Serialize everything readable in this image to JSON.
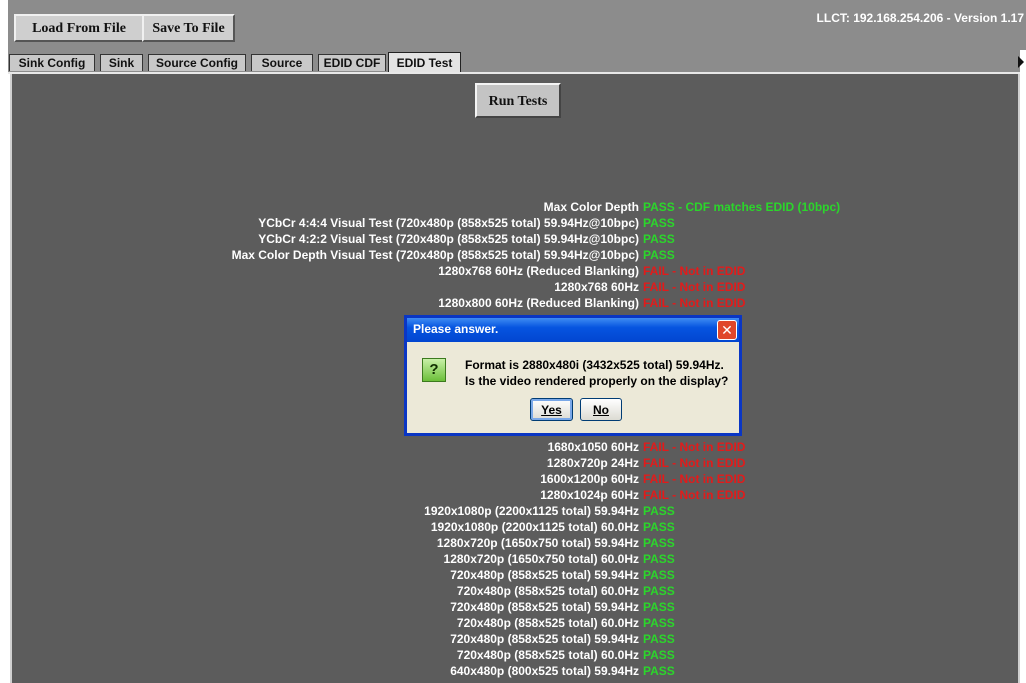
{
  "toolbar": {
    "load_label": "Load From File",
    "save_label": "Save To File",
    "title": "LLCT:  192.168.254.206 - Version 1.17"
  },
  "tabs": [
    {
      "label": "Sink Config"
    },
    {
      "label": "Sink"
    },
    {
      "label": "Source Config"
    },
    {
      "label": "Source"
    },
    {
      "label": "EDID CDF"
    },
    {
      "label": "EDID Test",
      "active": true
    }
  ],
  "run_tests_label": "Run Tests",
  "results": [
    {
      "label": "Max Color Depth",
      "result": "PASS - CDF matches EDID (10bpc)",
      "status": "pass"
    },
    {
      "label": "YCbCr 4:4:4 Visual Test (720x480p (858x525 total) 59.94Hz@10bpc)",
      "result": "PASS",
      "status": "pass"
    },
    {
      "label": "YCbCr 4:2:2 Visual Test (720x480p (858x525 total) 59.94Hz@10bpc)",
      "result": "PASS",
      "status": "pass"
    },
    {
      "label": "Max Color Depth Visual Test (720x480p (858x525 total) 59.94Hz@10bpc)",
      "result": "PASS",
      "status": "pass"
    },
    {
      "label": "1280x768 60Hz (Reduced Blanking)",
      "result": "FAIL - Not in EDID",
      "status": "fail"
    },
    {
      "label": "1280x768 60Hz",
      "result": "FAIL - Not in EDID",
      "status": "fail"
    },
    {
      "label": "1280x800 60Hz (Reduced Blanking)",
      "result": "FAIL - Not in EDID",
      "status": "fail"
    },
    {
      "label": "1680x1050 60Hz",
      "result": "FAIL - Not in EDID",
      "status": "fail"
    },
    {
      "label": "1280x720p 24Hz",
      "result": "FAIL - Not in EDID",
      "status": "fail"
    },
    {
      "label": "1600x1200p 60Hz",
      "result": "FAIL - Not in EDID",
      "status": "fail"
    },
    {
      "label": "1280x1024p 60Hz",
      "result": "FAIL - Not in EDID",
      "status": "fail"
    },
    {
      "label": "1920x1080p (2200x1125 total) 59.94Hz",
      "result": "PASS",
      "status": "pass"
    },
    {
      "label": "1920x1080p (2200x1125 total) 60.0Hz",
      "result": "PASS",
      "status": "pass"
    },
    {
      "label": "1280x720p (1650x750 total) 59.94Hz",
      "result": "PASS",
      "status": "pass"
    },
    {
      "label": "1280x720p (1650x750 total) 60.0Hz",
      "result": "PASS",
      "status": "pass"
    },
    {
      "label": "720x480p (858x525 total) 59.94Hz",
      "result": "PASS",
      "status": "pass"
    },
    {
      "label": "720x480p (858x525 total) 60.0Hz",
      "result": "PASS",
      "status": "pass"
    },
    {
      "label": "720x480p (858x525 total) 59.94Hz",
      "result": "PASS",
      "status": "pass"
    },
    {
      "label": "720x480p (858x525 total) 60.0Hz",
      "result": "PASS",
      "status": "pass"
    },
    {
      "label": "720x480p (858x525 total) 59.94Hz",
      "result": "PASS",
      "status": "pass"
    },
    {
      "label": "720x480p (858x525 total) 60.0Hz",
      "result": "PASS",
      "status": "pass"
    },
    {
      "label": "640x480p (800x525 total) 59.94Hz",
      "result": "PASS",
      "status": "pass"
    }
  ],
  "dialog": {
    "title": "Please answer.",
    "line1": "Format is 2880x480i (3432x525 total) 59.94Hz.",
    "line2": "Is the video rendered properly on the display?",
    "yes_label": "Yes",
    "no_label": "No",
    "close_glyph": "✕",
    "icon_glyph": "?"
  },
  "colors": {
    "pass": "#2bd62b",
    "fail": "#e21b1b",
    "panel": "#5c5c5c",
    "toolbar": "#8c8c8c"
  }
}
